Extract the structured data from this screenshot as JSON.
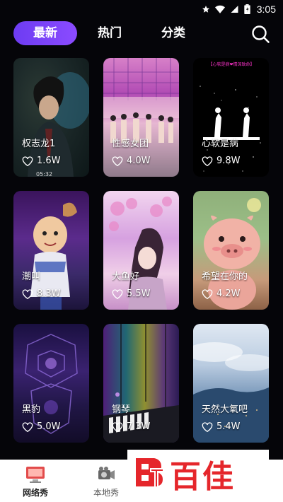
{
  "status_bar": {
    "time": "3:05"
  },
  "tabs": [
    {
      "label": "最新",
      "active": true
    },
    {
      "label": "热门",
      "active": false
    },
    {
      "label": "分类",
      "active": false
    }
  ],
  "cards": [
    {
      "title": "权志龙1",
      "likes": "1.6W",
      "time": "05:32"
    },
    {
      "title": "性感女团",
      "likes": "4.0W"
    },
    {
      "title": "心软是病",
      "likes": "9.8W",
      "caption": "【心软是病❤情深致命】"
    },
    {
      "title": "潮叫",
      "likes": "8.3W"
    },
    {
      "title": "大鱼好",
      "likes": "5.5W"
    },
    {
      "title": "希望在你的",
      "likes": "4.2W"
    },
    {
      "title": "黑豹",
      "likes": "5.0W"
    },
    {
      "title": "钢琴",
      "likes": "7.3W"
    },
    {
      "title": "天然大氧吧",
      "likes": "5.4W"
    }
  ],
  "bottom_nav": [
    {
      "label": "网络秀",
      "active": true
    },
    {
      "label": "本地秀",
      "active": false
    }
  ],
  "watermark": {
    "text": "百佳"
  },
  "colors": {
    "accent": "#7a44f7",
    "watermark": "#e5262b",
    "background": "#050509"
  }
}
